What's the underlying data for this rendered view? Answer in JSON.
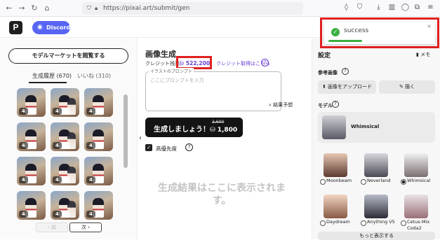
{
  "browser": {
    "url": "https://pixai.art/submit/gen"
  },
  "header": {
    "logo_letter": "P",
    "discord_label": "Discord"
  },
  "toast": {
    "message": "success",
    "close": "×",
    "status_color": "#3cb043"
  },
  "left": {
    "market_button": "モデルマーケットを閲覧する",
    "tabs": [
      {
        "label": "生成履歴 (670)"
      },
      {
        "label": "いいね (310)"
      }
    ],
    "thumb_badge": "4",
    "prev": "‹ 前",
    "next": "次 ›"
  },
  "center": {
    "title": "画像生成",
    "credit_label": "クレジット残高：",
    "credit_value": "522,200",
    "credit_link": "クレジット取得はこちら",
    "prompt_label": "イラストのプロンプト",
    "prompt_placeholder": "ここにプロンプトを入力",
    "predict_label": "結果予想",
    "generate_label": "生成しましょう！",
    "old_cost": "2,600",
    "new_cost": "1,800",
    "priority_label": "高優先度",
    "result_placeholder": "生成結果はここに表示されます。"
  },
  "right": {
    "title": "設定",
    "memo": "メモ",
    "ref_label": "参考画像",
    "upload_label": "画像をアップロード",
    "draw_label": "描く",
    "model_label": "モデル",
    "selected_model": "Whimsical",
    "models": [
      {
        "name": "Moonbeam",
        "selected": false
      },
      {
        "name": "Neverland",
        "selected": false
      },
      {
        "name": "Whimsical",
        "selected": true
      },
      {
        "name": "Daydream",
        "selected": false
      },
      {
        "name": "Anything V5",
        "selected": false
      },
      {
        "name": "Cetus-Mix Coda2",
        "selected": false
      }
    ],
    "more_label": "もっと表示する"
  },
  "colors": {
    "accent": "#6b3fd4",
    "discord": "#5865f2",
    "highlight": "#e02020"
  }
}
